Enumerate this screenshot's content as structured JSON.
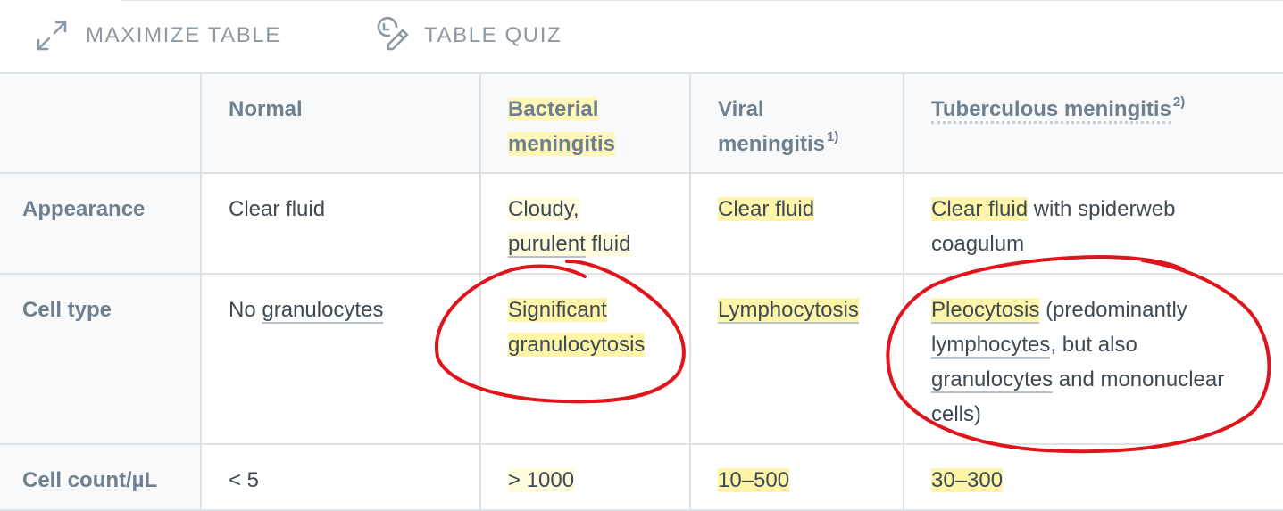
{
  "toolbar": {
    "maximize_label": "MAXIMIZE TABLE",
    "quiz_label": "TABLE QUIZ"
  },
  "table": {
    "headers": {
      "normal": "Normal",
      "bacterial": "Bacterial meningitis",
      "viral": "Viral meningitis",
      "viral_sup": "1)",
      "tuberculous": "Tuberculous meningitis",
      "tuberculous_sup": "2)"
    },
    "rows": {
      "appearance": {
        "label": "Appearance",
        "normal": "Clear fluid",
        "bacterial_a": "Cloudy,",
        "bacterial_b": "purulent",
        "bacterial_c": "fluid",
        "viral": "Clear fluid",
        "tuberculous_a": "Clear fluid",
        "tuberculous_b": "with spiderweb coagulum"
      },
      "cell_type": {
        "label": "Cell type",
        "normal_a": "No",
        "normal_b": "granulocytes",
        "bacterial_a": "Significant",
        "bacterial_b": "granulocytosis",
        "viral": "Lymphocytosis",
        "tuberculous_a": "Pleocytosis",
        "tuberculous_b": "(predominantly",
        "tuberculous_c": "lymphocytes",
        "tuberculous_d": ", but also",
        "tuberculous_e": "granulocytes",
        "tuberculous_f": "and mononuclear cells)"
      },
      "cell_count": {
        "label": "Cell count/µL",
        "normal": "< 5",
        "bacterial": "> 1000",
        "viral": "10–500",
        "tuberculous": "30–300"
      }
    }
  },
  "colors": {
    "highlight": "#fff5a8",
    "annotation": "#e0141b",
    "header_text": "#6e7f8f",
    "toolbar_text": "#8b98a5"
  }
}
